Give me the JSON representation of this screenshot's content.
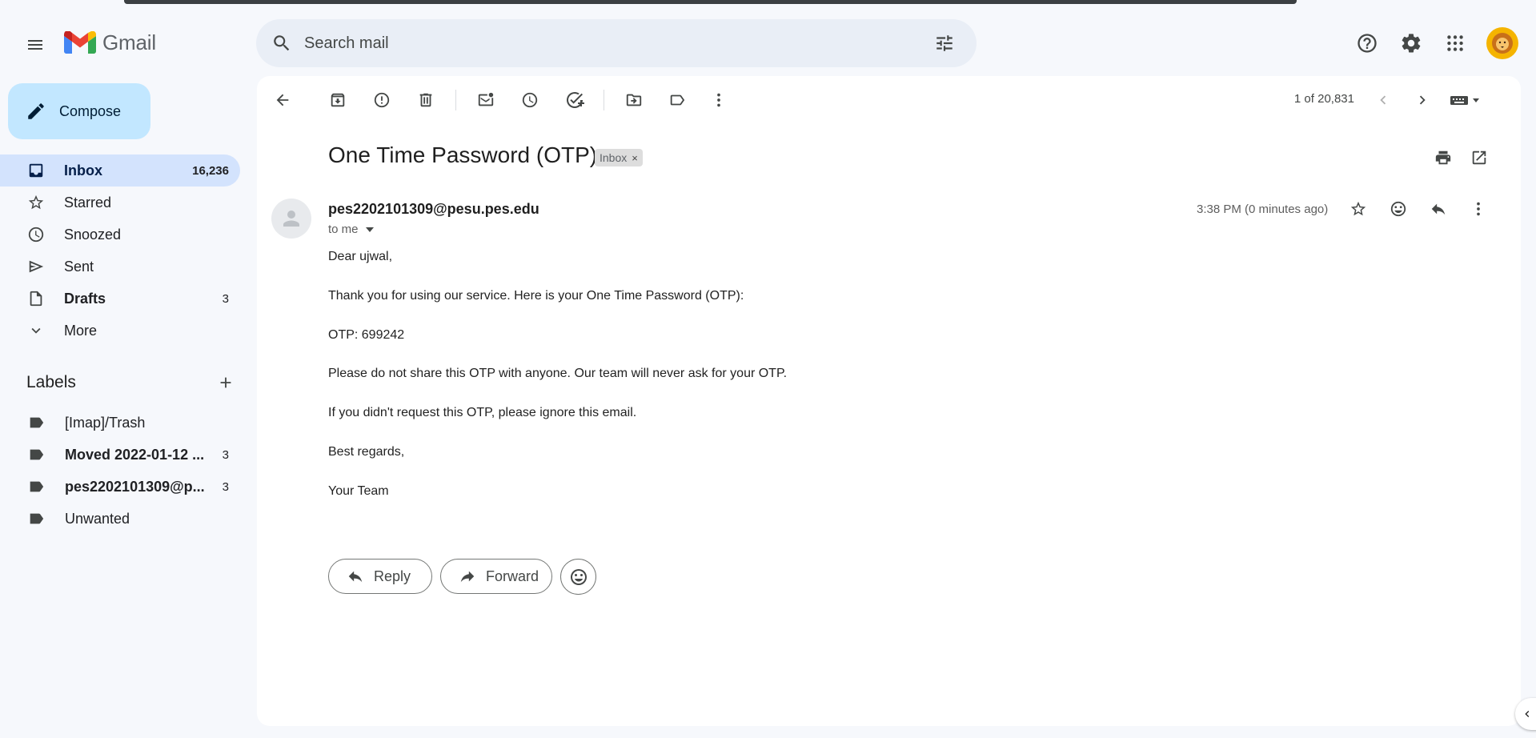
{
  "app": {
    "logo_text": "Gmail"
  },
  "search": {
    "placeholder": "Search mail"
  },
  "sidebar": {
    "compose_label": "Compose",
    "items": [
      {
        "label": "Inbox",
        "count": "16,236"
      },
      {
        "label": "Starred",
        "count": ""
      },
      {
        "label": "Snoozed",
        "count": ""
      },
      {
        "label": "Sent",
        "count": ""
      },
      {
        "label": "Drafts",
        "count": "3"
      },
      {
        "label": "More",
        "count": ""
      }
    ],
    "labels_title": "Labels",
    "labels": [
      {
        "label": "[Imap]/Trash",
        "count": ""
      },
      {
        "label": "Moved 2022-01-12 ...",
        "count": "3"
      },
      {
        "label": "pes2202101309@p...",
        "count": "3"
      },
      {
        "label": "Unwanted",
        "count": ""
      }
    ]
  },
  "toolbar": {
    "pager": "1 of 20,831"
  },
  "email": {
    "subject": "One Time Password (OTP)",
    "label_chip": "Inbox",
    "chip_close": "×",
    "sender": "pes2202101309@pesu.pes.edu",
    "to": "to me",
    "time": "3:38 PM (0 minutes ago)",
    "body": [
      "Dear ujwal,",
      " Thank you for using our service. Here is your One Time Password (OTP):",
      " OTP: 699242",
      "  Please do not share this OTP with anyone. Our team will never ask for your OTP.",
      " If you didn't request this OTP, please ignore this email.",
      " Best regards,",
      " Your Team"
    ]
  },
  "actions": {
    "reply": "Reply",
    "forward": "Forward"
  },
  "colors": {
    "accent": "#0b57d0",
    "compose_bg": "#c2e7ff",
    "active_nav": "#d3e3fd"
  }
}
